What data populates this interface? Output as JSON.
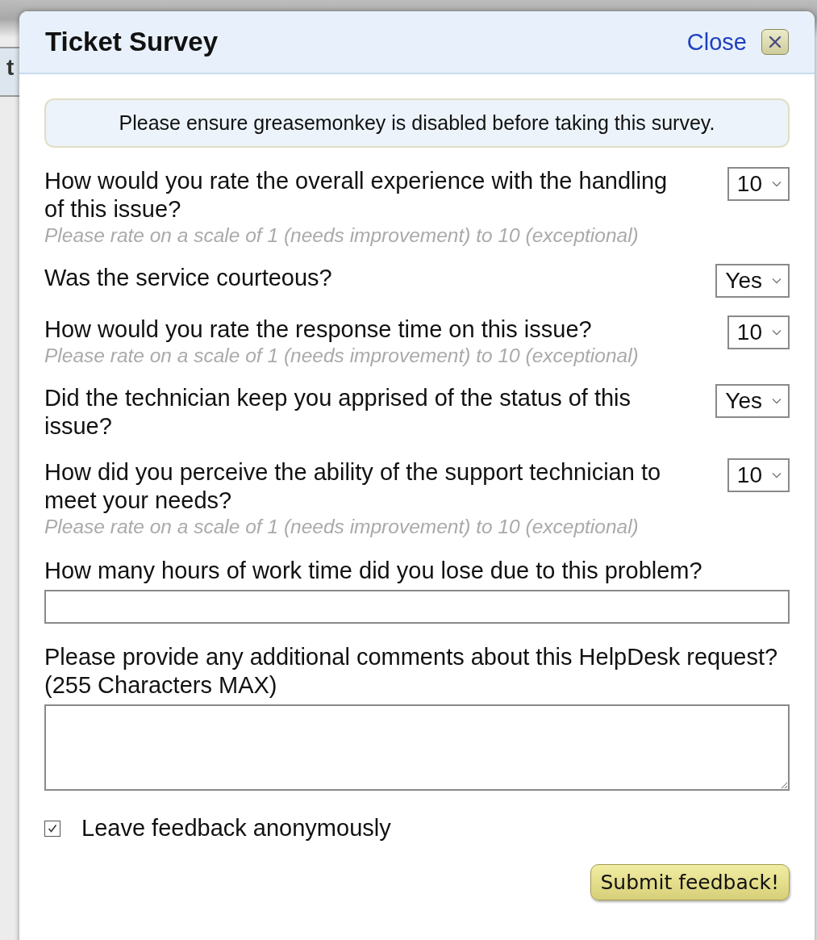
{
  "background": {
    "fragments": [
      "t"
    ]
  },
  "dialog": {
    "title": "Ticket Survey",
    "close_label": "Close"
  },
  "notice": "Please ensure greasemonkey is disabled before taking this survey.",
  "questions": [
    {
      "kind": "select",
      "text": "How would you rate the overall experience with the handling of this issue?",
      "value": "10",
      "hint": "Please rate on a scale of 1 (needs improvement) to 10 (exceptional)"
    },
    {
      "kind": "select",
      "text": "Was the service courteous?",
      "value": "Yes"
    },
    {
      "kind": "select",
      "text": "How would you rate the response time on this issue?",
      "value": "10",
      "hint": "Please rate on a scale of 1 (needs improvement) to 10 (exceptional)"
    },
    {
      "kind": "select",
      "text": "Did the technician keep you apprised of the status of this issue?",
      "value": "Yes"
    },
    {
      "kind": "select",
      "text": "How did you perceive the ability of the support technician to meet your needs?",
      "value": "10",
      "hint": "Please rate on a scale of 1 (needs improvement) to 10 (exceptional)"
    },
    {
      "kind": "input",
      "text": "How many hours of work time did you lose due to this problem?"
    },
    {
      "kind": "textarea",
      "text": "Please provide any additional comments about this HelpDesk request?\n(255 Characters MAX)"
    }
  ],
  "anonymous": {
    "label": "Leave feedback anonymously",
    "checked": true
  },
  "submit": "Submit feedback!"
}
